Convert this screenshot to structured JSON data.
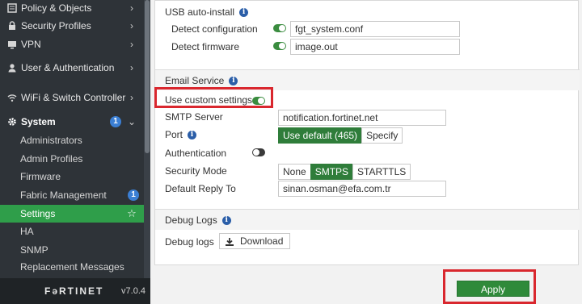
{
  "sidebar": {
    "items": [
      {
        "label": "Policy & Objects",
        "icon": "policy-icon"
      },
      {
        "label": "Security Profiles",
        "icon": "lock-icon"
      },
      {
        "label": "VPN",
        "icon": "monitor-icon"
      },
      {
        "label": "User & Authentication",
        "icon": "user-icon"
      },
      {
        "label": "WiFi & Switch Controller",
        "icon": "wifi-icon"
      },
      {
        "label": "System",
        "icon": "gear-icon",
        "badge": "1"
      }
    ],
    "sub_items": [
      {
        "label": "Administrators"
      },
      {
        "label": "Admin Profiles"
      },
      {
        "label": "Firmware"
      },
      {
        "label": "Fabric Management",
        "badge": "1"
      },
      {
        "label": "Settings"
      },
      {
        "label": "HA"
      },
      {
        "label": "SNMP"
      },
      {
        "label": "Replacement Messages"
      }
    ],
    "logo": "FəRTINET",
    "version": "v7.0.4"
  },
  "usb": {
    "title": "USB auto-install",
    "detect_config_label": "Detect configuration",
    "detect_config_value": "fgt_system.conf",
    "detect_firmware_label": "Detect firmware",
    "detect_firmware_value": "image.out"
  },
  "email": {
    "title": "Email Service",
    "custom_label": "Use custom settings",
    "smtp_label": "SMTP Server",
    "smtp_value": "notification.fortinet.net",
    "port_label": "Port",
    "port_default": "Use default (465)",
    "port_specify": "Specify",
    "auth_label": "Authentication",
    "security_label": "Security Mode",
    "security_options": [
      "None",
      "SMTPS",
      "STARTTLS"
    ],
    "reply_label": "Default Reply To",
    "reply_value": "sinan.osman@efa.com.tr"
  },
  "debug": {
    "title": "Debug Logs",
    "label": "Debug logs",
    "download": "Download"
  },
  "apply_label": "Apply",
  "colors": {
    "accent": "#2f8a3a",
    "highlight": "#d9272e",
    "info": "#2b5ea8",
    "badge": "#3b7fd4"
  }
}
